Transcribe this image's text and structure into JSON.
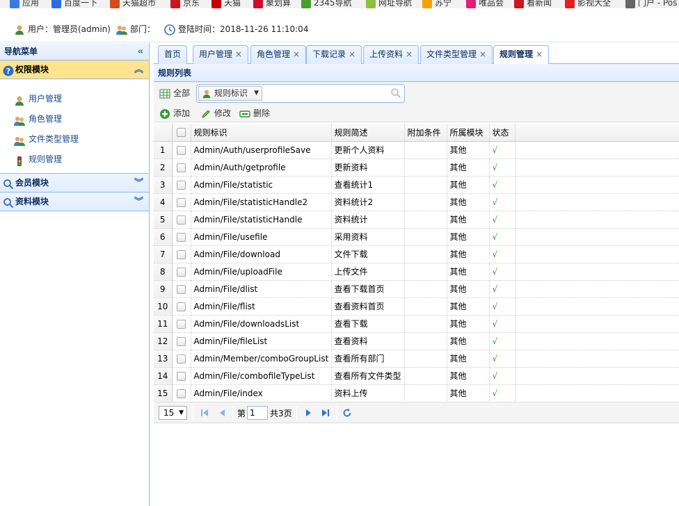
{
  "bookmarks": [
    {
      "label": "应用",
      "color": "#3a7be0"
    },
    {
      "label": "百度一下",
      "color": "#2f6be0"
    },
    {
      "label": "天猫超市",
      "color": "#d44b1e"
    },
    {
      "label": "京东",
      "color": "#c81623"
    },
    {
      "label": "天猫",
      "color": "#c40000"
    },
    {
      "label": "聚划算",
      "color": "#c8102e"
    },
    {
      "label": "2345导航",
      "color": "#4a9e2f"
    },
    {
      "label": "网址导航",
      "color": "#8cbf3f"
    },
    {
      "label": "苏宁",
      "color": "#f0a500"
    },
    {
      "label": "唯品会",
      "color": "#e01e74"
    },
    {
      "label": "看新闻",
      "color": "#c81623"
    },
    {
      "label": "影视大全",
      "color": "#e02020"
    },
    {
      "label": "门户 - Pos",
      "color": "#666666"
    }
  ],
  "info": {
    "user": "用户：管理员(admin)",
    "dept": "部门：",
    "login": "登陆时间：2018-11-26 11:10:04"
  },
  "nav": {
    "title": "导航菜单",
    "modules": [
      {
        "label": "权限模块",
        "icon": "help-icon"
      },
      {
        "label": "会员模块",
        "icon": "search-icon"
      },
      {
        "label": "资料模块",
        "icon": "search-icon"
      }
    ],
    "items": [
      {
        "label": "用户管理",
        "icon": "user-icon"
      },
      {
        "label": "角色管理",
        "icon": "users-icon"
      },
      {
        "label": "文件类型管理",
        "icon": "users-icon"
      },
      {
        "label": "规则管理",
        "icon": "traffic-light-icon"
      }
    ]
  },
  "tabs": [
    {
      "label": "首页",
      "closable": false
    },
    {
      "label": "用户管理",
      "closable": true
    },
    {
      "label": "角色管理",
      "closable": true
    },
    {
      "label": "下载记录",
      "closable": true
    },
    {
      "label": "上传资料",
      "closable": true
    },
    {
      "label": "文件类型管理",
      "closable": true
    },
    {
      "label": "规则管理",
      "closable": true
    }
  ],
  "panel": {
    "title": "规则列表",
    "all_label": "全部",
    "search_field": "规则标识",
    "search_placeholder": "",
    "add_label": "添加",
    "edit_label": "修改",
    "delete_label": "删除"
  },
  "grid": {
    "headers": [
      "规则标识",
      "规则简述",
      "附加条件",
      "所属模块",
      "状态"
    ],
    "rows": [
      [
        "1",
        "Admin/Auth/userprofileSave",
        "更新个人资料",
        "",
        "其他",
        "√"
      ],
      [
        "2",
        "Admin/Auth/getprofile",
        "更新资料",
        "",
        "其他",
        "√"
      ],
      [
        "3",
        "Admin/File/statistic",
        "查看统计1",
        "",
        "其他",
        "√"
      ],
      [
        "4",
        "Admin/File/statisticHandle2",
        "资料统计2",
        "",
        "其他",
        "√"
      ],
      [
        "5",
        "Admin/File/statisticHandle",
        "资料统计",
        "",
        "其他",
        "√"
      ],
      [
        "6",
        "Admin/File/usefile",
        "采用资料",
        "",
        "其他",
        "√"
      ],
      [
        "7",
        "Admin/File/download",
        "文件下载",
        "",
        "其他",
        "√"
      ],
      [
        "8",
        "Admin/File/uploadFile",
        "上传文件",
        "",
        "其他",
        "√"
      ],
      [
        "9",
        "Admin/File/dlist",
        "查看下载首页",
        "",
        "其他",
        "√"
      ],
      [
        "10",
        "Admin/File/flist",
        "查看资料首页",
        "",
        "其他",
        "√"
      ],
      [
        "11",
        "Admin/File/downloadsList",
        "查看下载",
        "",
        "其他",
        "√"
      ],
      [
        "12",
        "Admin/File/fileList",
        "查看资料",
        "",
        "其他",
        "√"
      ],
      [
        "13",
        "Admin/Member/comboGroupList",
        "查看所有部门",
        "",
        "其他",
        "√"
      ],
      [
        "14",
        "Admin/File/combofileTypeList",
        "查看所有文件类型",
        "",
        "其他",
        "√"
      ],
      [
        "15",
        "Admin/File/index",
        "资料上传",
        "",
        "其他",
        "√"
      ]
    ]
  },
  "pager": {
    "page_size": "15",
    "page_prefix": "第",
    "page_value": "1",
    "page_suffix": "共3页"
  },
  "colors": {
    "accent": "#95b8e7",
    "active_module": "#ffe48d",
    "status_ok": "#1aa01a"
  }
}
